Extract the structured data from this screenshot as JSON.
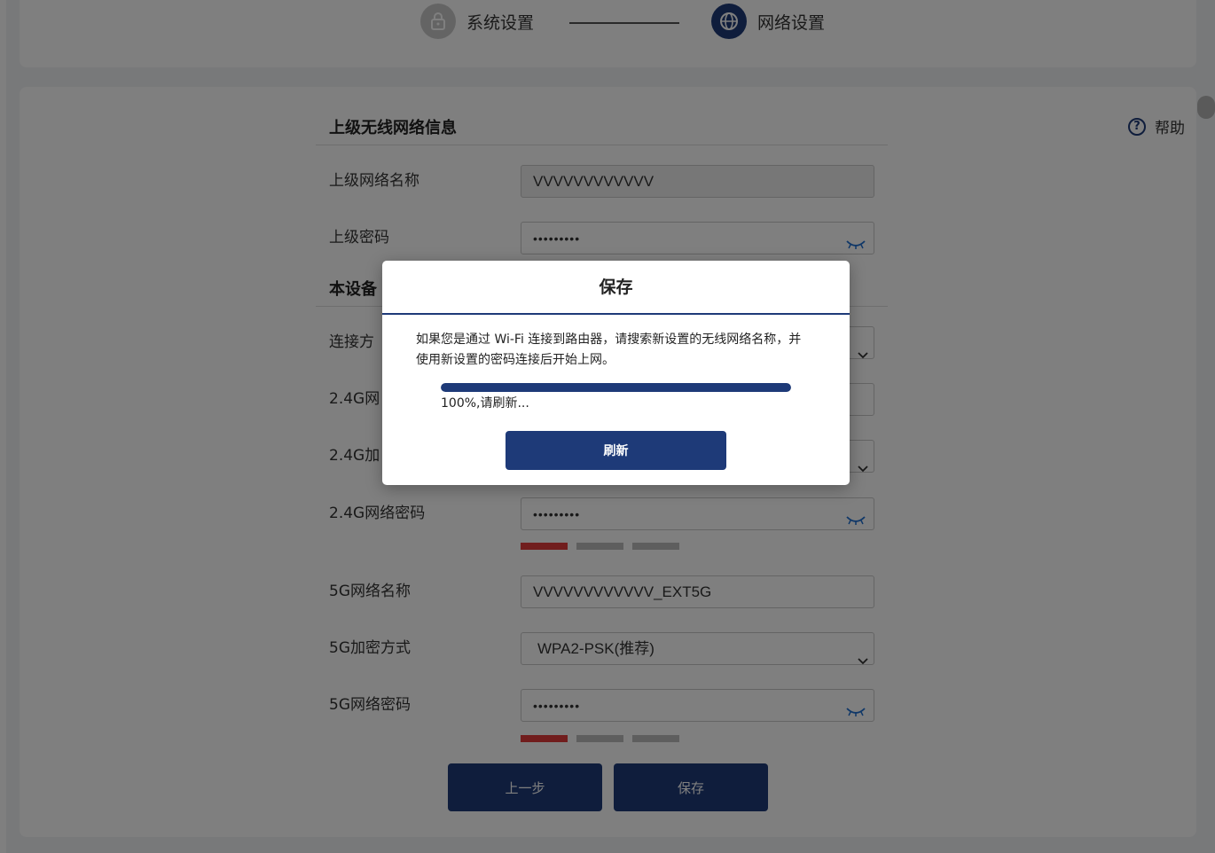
{
  "steps": [
    {
      "label": "系统设置",
      "icon": "lock-icon",
      "state": "done"
    },
    {
      "label": "网络设置",
      "icon": "globe-icon",
      "state": "active"
    }
  ],
  "help": {
    "label": "帮助",
    "icon": "question-circle-icon"
  },
  "upstream": {
    "section_title": "上级无线网络信息",
    "ssid_label": "上级网络名称",
    "ssid_value": "VVVVVVVVVVVV",
    "password_label": "上级密码",
    "password_value": "•••••••••"
  },
  "device": {
    "section_title": "本设备",
    "connect_label": "连接方",
    "ssid24_label": "2.4G网",
    "enc24_label": "2.4G加",
    "pwd24_label": "2.4G网络密码",
    "pwd24_value": "•••••••••",
    "pwd24_strength": 1,
    "ssid5_label": "5G网络名称",
    "ssid5_value": "VVVVVVVVVVVV_EXT5G",
    "enc5_label": "5G加密方式",
    "enc5_value": "WPA2-PSK(推荐)",
    "pwd5_label": "5G网络密码",
    "pwd5_value": "•••••••••",
    "pwd5_strength": 1
  },
  "buttons": {
    "prev": "上一步",
    "save": "保存"
  },
  "modal": {
    "title": "保存",
    "message": "如果您是通过 Wi-Fi 连接到路由器，请搜索新设置的无线网络名称，并使用新设置的密码连接后开始上网。",
    "progress": 1.0,
    "progress_text": "100%,请刷新...",
    "refresh_label": "刷新"
  },
  "colors": {
    "accent": "#1e3a78",
    "weak": "#e23b3b",
    "bg": "#f0f2f5"
  }
}
